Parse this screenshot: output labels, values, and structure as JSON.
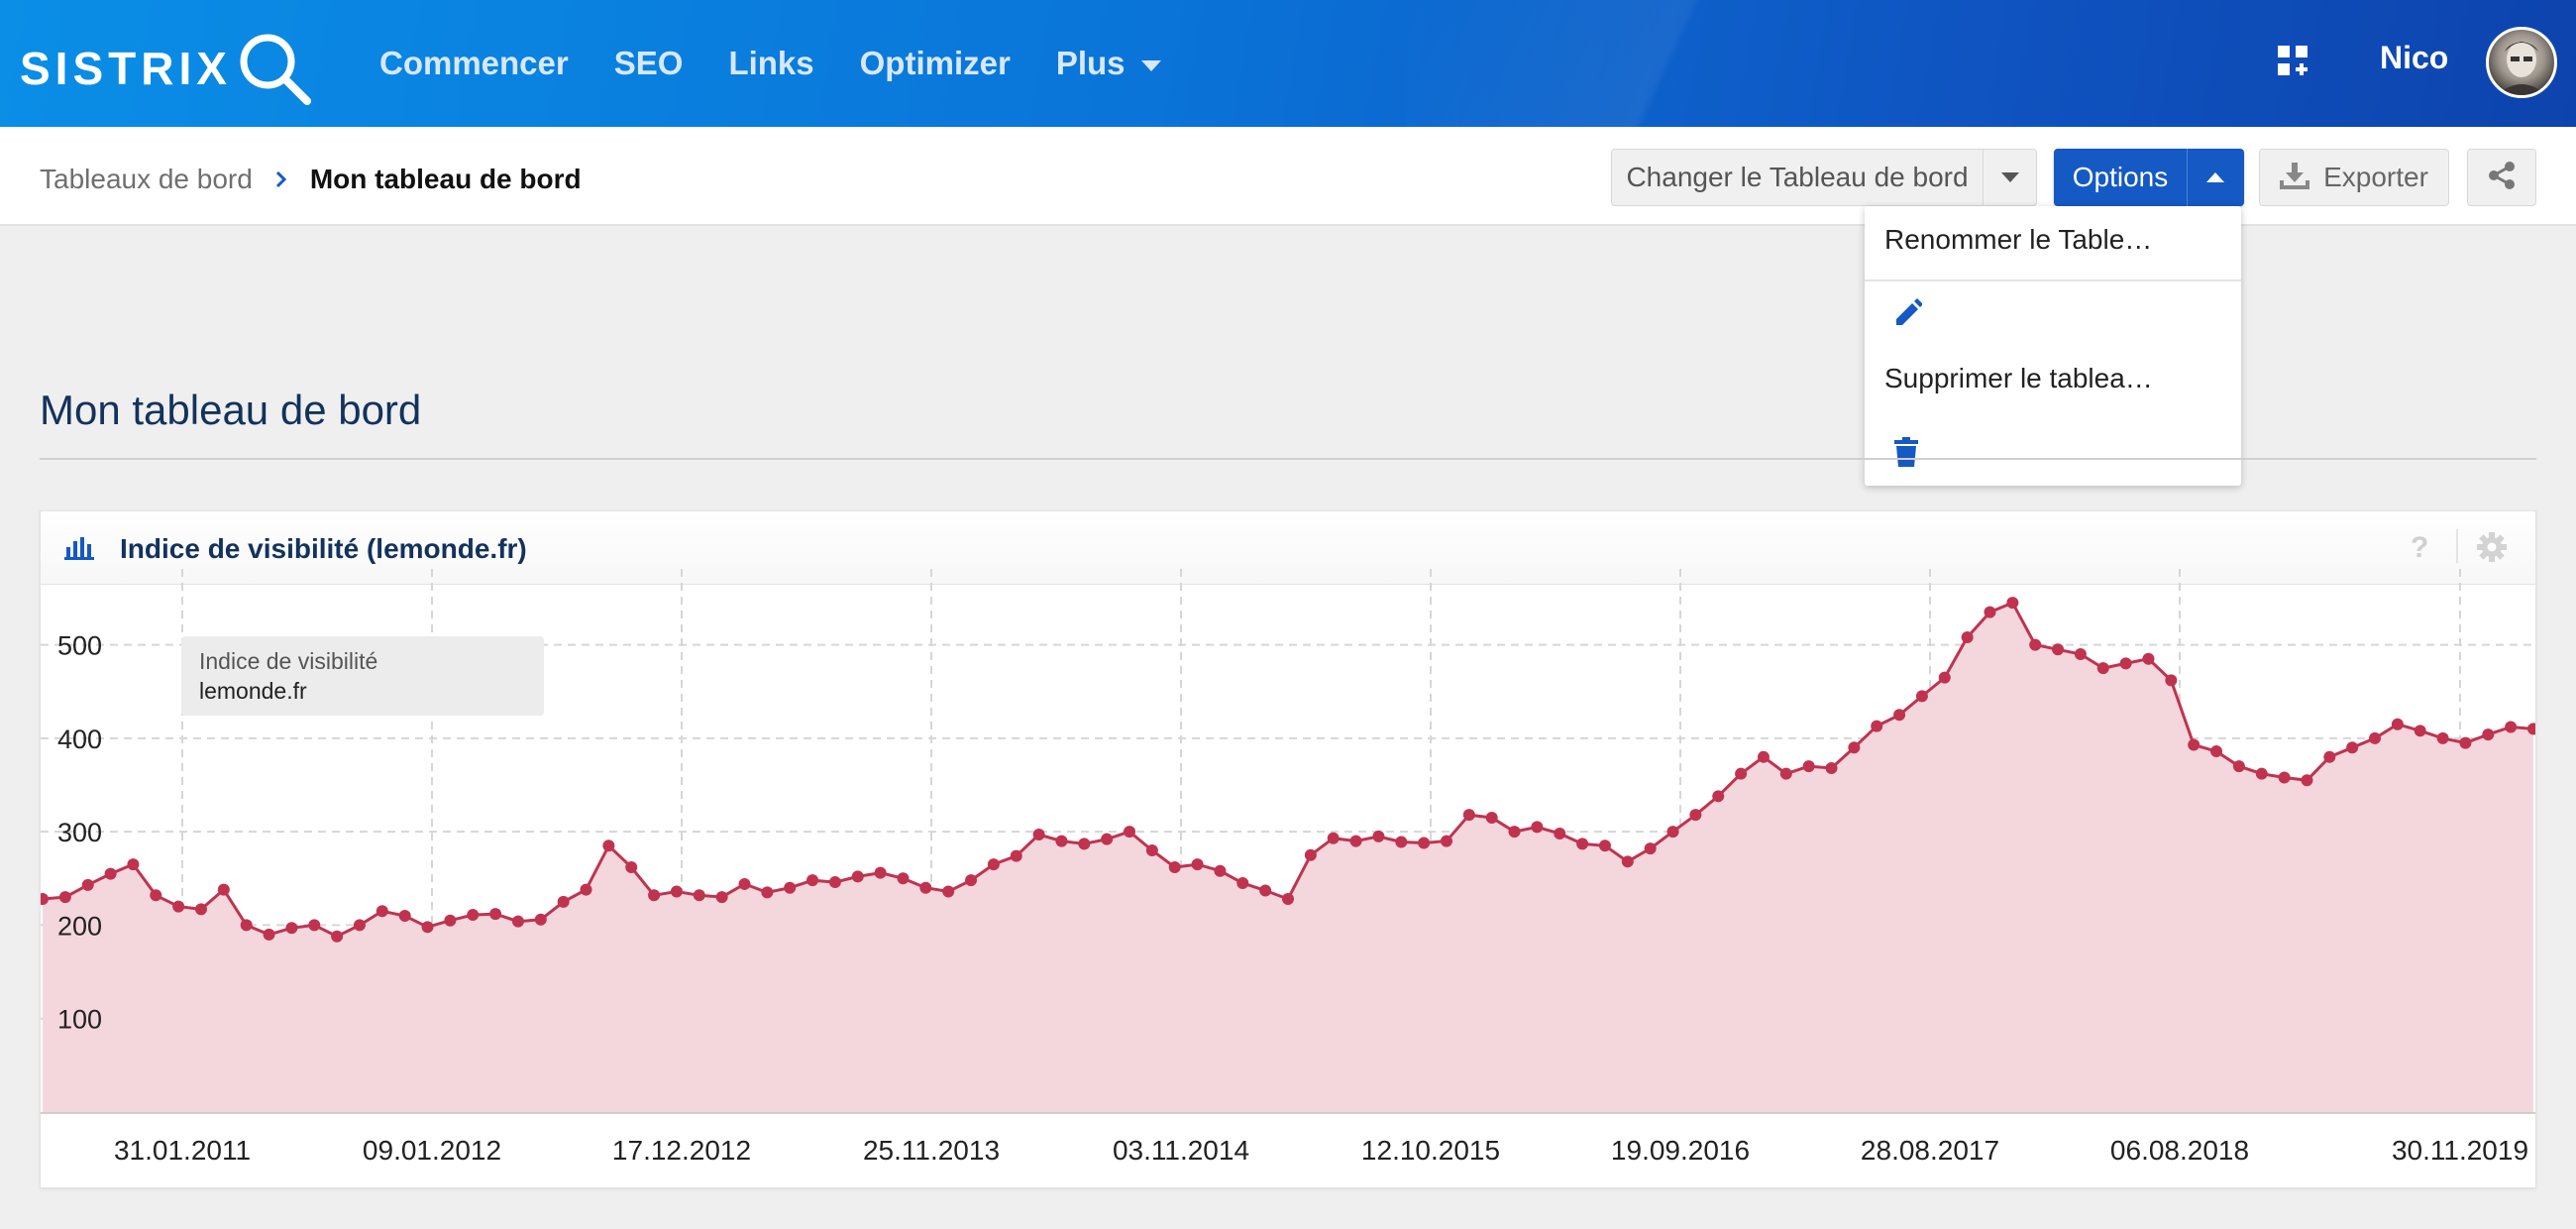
{
  "brand": {
    "logo_text": "SISTRIX"
  },
  "nav": {
    "items": [
      "Commencer",
      "SEO",
      "Links",
      "Optimizer",
      "Plus"
    ]
  },
  "user": {
    "name": "Nico"
  },
  "breadcrumb": {
    "parent": "Tableaux de bord",
    "current": "Mon tableau de bord"
  },
  "toolbar": {
    "change_label": "Changer le Tableau de bord",
    "options_label": "Options",
    "export_label": "Exporter"
  },
  "dropdown": {
    "rename_label": "Renommer le Table…",
    "delete_label": "Supprimer le tablea…"
  },
  "page": {
    "title": "Mon tableau de bord"
  },
  "card": {
    "title": "Indice de visibilité (lemonde.fr)",
    "help": "?"
  },
  "colors": {
    "accent": "#1559c4",
    "series_line": "#c0334f",
    "series_fill": "#f4d7dd"
  },
  "chart_data": {
    "type": "area",
    "title": "Indice de visibilité (lemonde.fr)",
    "legend": {
      "label": "Indice de visibilité",
      "series": "lemonde.fr",
      "position": "top-left"
    },
    "xlabel": "",
    "ylabel": "",
    "ylim": [
      0,
      560
    ],
    "y_ticks": [
      100,
      200,
      300,
      400,
      500
    ],
    "x_tick_labels": [
      "31.01.2011",
      "09.01.2012",
      "17.12.2012",
      "25.11.2013",
      "03.11.2014",
      "12.10.2015",
      "19.09.2016",
      "28.08.2017",
      "06.08.2018",
      "30.11.2019"
    ],
    "grid": true,
    "series": [
      {
        "name": "lemonde.fr",
        "values": [
          228,
          230,
          243,
          255,
          265,
          232,
          220,
          217,
          238,
          200,
          190,
          197,
          200,
          188,
          200,
          215,
          210,
          198,
          205,
          211,
          212,
          204,
          206,
          225,
          238,
          285,
          262,
          232,
          236,
          232,
          230,
          244,
          235,
          240,
          248,
          246,
          252,
          256,
          250,
          240,
          236,
          248,
          265,
          274,
          297,
          290,
          287,
          292,
          300,
          280,
          262,
          265,
          258,
          245,
          237,
          228,
          275,
          293,
          290,
          295,
          289,
          288,
          290,
          318,
          315,
          300,
          305,
          298,
          287,
          285,
          268,
          282,
          300,
          318,
          338,
          362,
          380,
          362,
          370,
          368,
          390,
          413,
          425,
          445,
          465,
          508,
          535,
          545,
          500,
          495,
          490,
          475,
          480,
          485,
          462,
          393,
          386,
          370,
          362,
          358,
          355,
          380,
          390,
          400,
          415,
          408,
          400,
          395,
          404,
          412,
          410
        ]
      }
    ]
  }
}
